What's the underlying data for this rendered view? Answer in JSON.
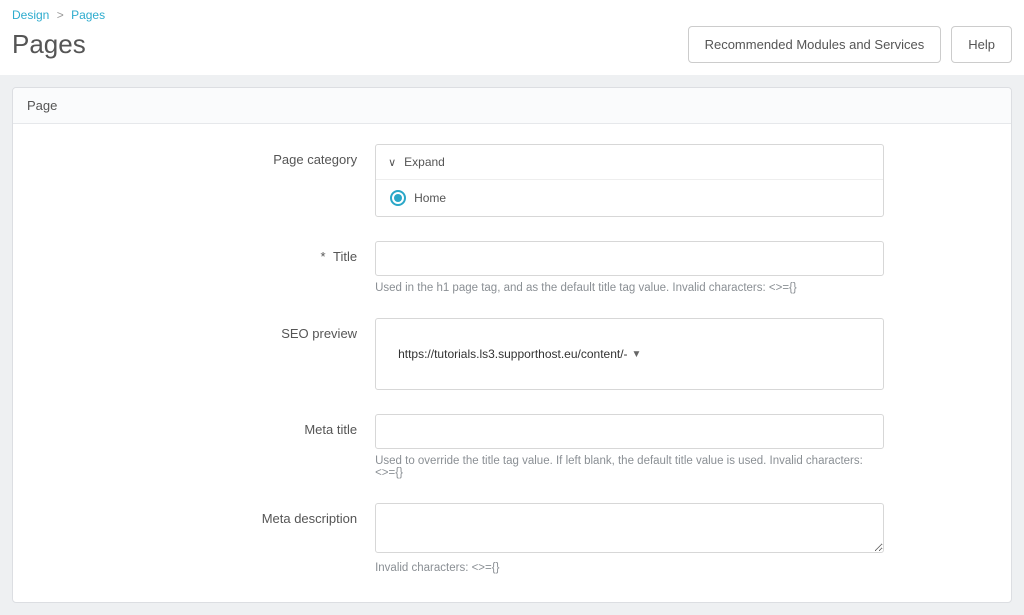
{
  "breadcrumb": {
    "item1": "Design",
    "separator": ">",
    "item2": "Pages"
  },
  "header": {
    "title": "Pages",
    "recommended_button": "Recommended Modules and Services",
    "help_button": "Help"
  },
  "panel": {
    "title": "Page"
  },
  "form": {
    "page_category": {
      "label": "Page category",
      "expand_label": "Expand",
      "option_home": "Home"
    },
    "title": {
      "required_mark": "*",
      "label": "Title",
      "value": "",
      "help": "Used in the h1 page tag, and as the default title tag value. Invalid characters: <>={}"
    },
    "seo_preview": {
      "label": "SEO preview",
      "url": "https://tutorials.ls3.supporthost.eu/content/-"
    },
    "meta_title": {
      "label": "Meta title",
      "value": "",
      "help": "Used to override the title tag value. If left blank, the default title value is used. Invalid characters: <>={}"
    },
    "meta_description": {
      "label": "Meta description",
      "value": "",
      "help": "Invalid characters: <>={}"
    }
  }
}
